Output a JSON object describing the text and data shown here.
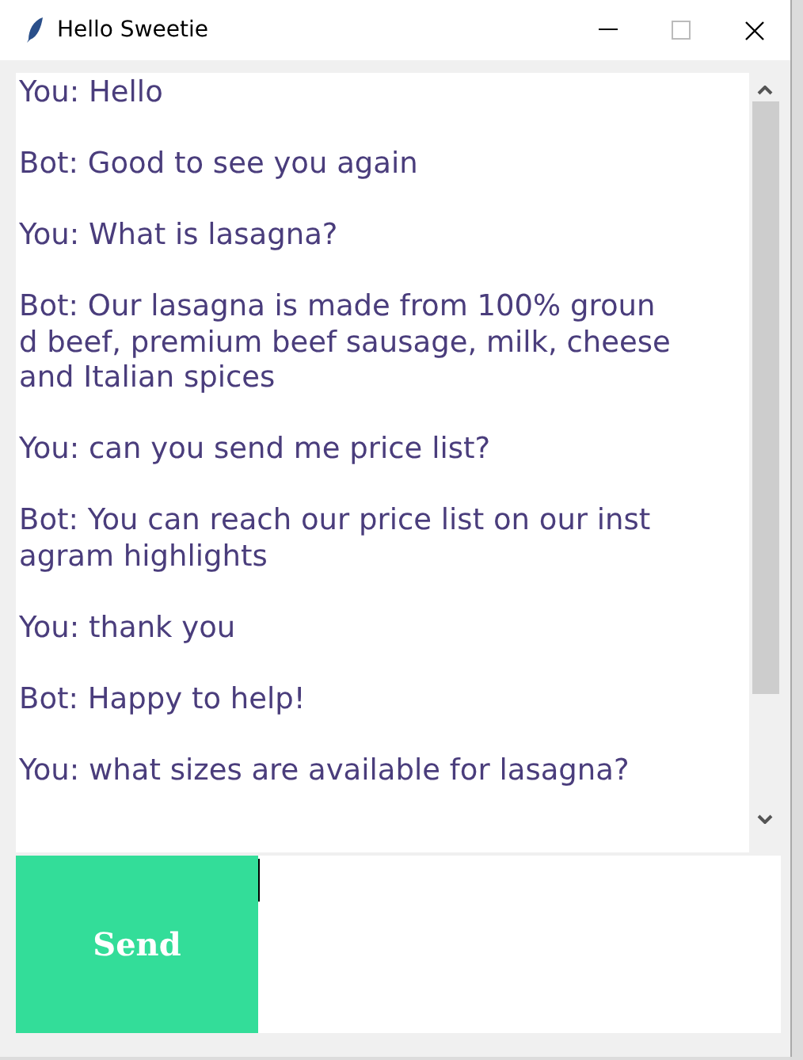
{
  "window": {
    "title": "Hello Sweetie"
  },
  "chat": {
    "messages": [
      {
        "lines": [
          "You: Hello"
        ]
      },
      {
        "lines": [
          "Bot: Good to see you again"
        ]
      },
      {
        "lines": [
          "You: What is lasagna?"
        ]
      },
      {
        "lines": [
          "Bot: Our lasagna is made from 100% groun",
          "d beef, premium beef sausage, milk, cheese",
          "and Italian spices"
        ]
      },
      {
        "lines": [
          "You: can you send me price list?"
        ]
      },
      {
        "lines": [
          "Bot: You can reach our price list on our inst",
          "agram highlights"
        ]
      },
      {
        "lines": [
          "You: thank you"
        ]
      },
      {
        "lines": [
          "Bot: Happy to help!"
        ]
      },
      {
        "lines": [
          "You: what sizes are available for lasagna?"
        ]
      }
    ]
  },
  "send_button": {
    "label": "Send"
  }
}
